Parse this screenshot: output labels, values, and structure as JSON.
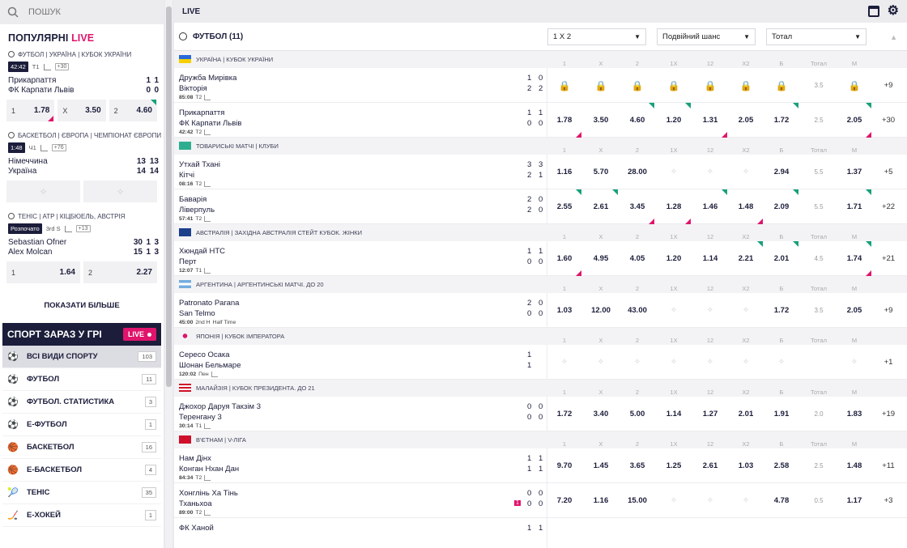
{
  "search": {
    "placeholder": "ПОШУК"
  },
  "popular": {
    "title": "ПОПУЛЯРНІ",
    "live": "LIVE"
  },
  "pop_matches": [
    {
      "league": "ФУТБОЛ | УКРАЇНА | КУБОК УКРАЇНИ",
      "time": "42:42",
      "period": "T1",
      "count": "+30",
      "team1": "Прикарпаття",
      "team2": "ФК Карпати Львів",
      "s1a": "1",
      "s1b": "1",
      "s2a": "0",
      "s2b": "0",
      "odds": [
        {
          "l": "1",
          "v": "1.78"
        },
        {
          "l": "X",
          "v": "3.50"
        },
        {
          "l": "2",
          "v": "4.60"
        }
      ]
    },
    {
      "league": "БАСКЕТБОЛ | ЄВРОПА | ЧЕМПІОНАТ ЄВРОПИ 2...",
      "time": "1:48",
      "period": "Ч1",
      "count": "+76",
      "team1": "Німеччина",
      "team2": "Україна",
      "s1a": "13",
      "s1b": "13",
      "s2a": "14",
      "s2b": "14"
    },
    {
      "league": "ТЕНІС | ATP | КІЦБЮЕЛЬ, АВСТРІЯ",
      "time": "Розпочато",
      "period": "3rd S",
      "count": "+13",
      "team1": "Sebastian Ofner",
      "team2": "Alex Molcan",
      "s1a": "30",
      "s1b": "1",
      "s1c": "3",
      "s2a": "15",
      "s2b": "1",
      "s2c": "3",
      "odds": [
        {
          "l": "1",
          "v": "1.64"
        },
        {
          "l": "2",
          "v": "2.27"
        }
      ]
    }
  ],
  "show_more": "ПОКАЗАТИ БІЛЬШЕ",
  "sport_now": {
    "title": "СПОРТ ЗАРАЗ У ГРІ",
    "live": "LIVE"
  },
  "sports": [
    {
      "label": "ВСІ ВИДИ СПОРТУ",
      "count": "103",
      "icon": "⚽"
    },
    {
      "label": "ФУТБОЛ",
      "count": "11",
      "icon": "⚽"
    },
    {
      "label": "ФУТБОЛ. СТАТИСТИКА",
      "count": "3",
      "icon": "⚽"
    },
    {
      "label": "Е-ФУТБОЛ",
      "count": "1",
      "icon": "⚽"
    },
    {
      "label": "БАСКЕТБОЛ",
      "count": "16",
      "icon": "🏀"
    },
    {
      "label": "Е-БАСКЕТБОЛ",
      "count": "4",
      "icon": "🏀"
    },
    {
      "label": "ТЕНІС",
      "count": "35",
      "icon": "🎾"
    },
    {
      "label": "Е-ХОКЕЙ",
      "count": "1",
      "icon": "🏒"
    }
  ],
  "topbar": {
    "title": "LIVE"
  },
  "football": {
    "title": "ФУТБОЛ (11)",
    "sel1": "1 X 2",
    "sel2": "Подвійний шанс",
    "sel3": "Тотал"
  },
  "columns": [
    "1",
    "X",
    "2",
    "1X",
    "12",
    "X2",
    "Б",
    "Тотал",
    "М"
  ],
  "leagues": [
    {
      "name": "УКРАЇНА | КУБОК УКРАЇНИ",
      "flag": "ua",
      "matches": [
        {
          "t1": "Дружба Мирівка",
          "t2": "Вікторія",
          "time": "85:08",
          "period": "T2",
          "extra": "",
          "sc": [
            "1",
            "0",
            "2",
            "2"
          ],
          "locked": true,
          "tot": "3.5",
          "plus": "+9"
        },
        {
          "t1": "Прикарпаття",
          "t2": "ФК Карпати Львів",
          "time": "42:42",
          "period": "T2",
          "extra": "",
          "sc": [
            "1",
            "1",
            "0",
            "0"
          ],
          "odds": [
            "1.78",
            "3.50",
            "4.60",
            "1.20",
            "1.31",
            "2.05",
            "1.72",
            "2.5",
            "2.05"
          ],
          "up": [
            2,
            3,
            6,
            8
          ],
          "dn": [
            0,
            4,
            8
          ],
          "plus": "+30"
        }
      ]
    },
    {
      "name": "ТОВАРИСЬКІ МАТЧІ | КЛУБИ",
      "flag": "intl",
      "matches": [
        {
          "t1": "Утхай Тхані",
          "t2": "Кітчі",
          "time": "08:16",
          "period": "T2",
          "extra": "",
          "sc": [
            "3",
            "3",
            "2",
            "1"
          ],
          "odds": [
            "1.16",
            "5.70",
            "28.00",
            "",
            "",
            "",
            "2.94",
            "5.5",
            "1.37"
          ],
          "plus": "+5"
        },
        {
          "t1": "Баварія",
          "t2": "Ліверпуль",
          "time": "57:41",
          "period": "T2",
          "extra": "",
          "sc": [
            "2",
            "0",
            "2",
            "0"
          ],
          "odds": [
            "2.55",
            "2.61",
            "3.45",
            "1.28",
            "1.46",
            "1.48",
            "2.09",
            "5.5",
            "1.71"
          ],
          "up": [
            0,
            1,
            4,
            6,
            8
          ],
          "dn": [
            2,
            3,
            5,
            7
          ],
          "plus": "+22"
        }
      ]
    },
    {
      "name": "АВСТРАЛІЯ | ЗАХІДНА АВСТРАЛІЯ СТЕЙТ КУБОК. ЖІНКИ",
      "flag": "au",
      "matches": [
        {
          "t1": "Хюндай НТС",
          "t2": "Перт",
          "time": "12:07",
          "period": "T1",
          "extra": "",
          "sc": [
            "1",
            "1",
            "0",
            "0"
          ],
          "odds": [
            "1.60",
            "4.95",
            "4.05",
            "1.20",
            "1.14",
            "2.21",
            "2.01",
            "4.5",
            "1.74"
          ],
          "up": [
            5,
            6,
            8
          ],
          "dn": [
            0,
            8
          ],
          "plus": "+21"
        }
      ]
    },
    {
      "name": "АРГЕНТИНА | АРГЕНТИНСЬКІ МАТЧІ. ДО 20",
      "flag": "ar",
      "matches": [
        {
          "t1": "Patronato Parana",
          "t2": "San Telmo",
          "time": "45:00",
          "period": "2nd H",
          "extra": "Half Time",
          "sc": [
            "2",
            "0",
            "0",
            "0"
          ],
          "odds": [
            "1.03",
            "12.00",
            "43.00",
            "",
            "",
            "",
            "1.72",
            "3.5",
            "2.05"
          ],
          "plus": "+9"
        }
      ]
    },
    {
      "name": "ЯПОНІЯ | КУБОК ІМПЕРАТОРА",
      "flag": "jp",
      "matches": [
        {
          "t1": "Сересо Осака",
          "t2": "Шонан Бельмаре",
          "time": "120:02",
          "period": "Пен",
          "extra": "",
          "sc": [
            "1",
            "",
            "1",
            ""
          ],
          "odds": [
            "",
            "",
            "",
            "",
            "",
            "",
            "",
            "",
            ""
          ],
          "plus": "+1"
        }
      ]
    },
    {
      "name": "МАЛАЙЗІЯ | КУБОК ПРЕЗИДЕНТА. ДО 21",
      "flag": "my",
      "matches": [
        {
          "t1": "Джохор Даруя Такзім 3",
          "t2": "Теренгану 3",
          "time": "30:14",
          "period": "T1",
          "extra": "",
          "sc": [
            "0",
            "0",
            "0",
            "0"
          ],
          "odds": [
            "1.72",
            "3.40",
            "5.00",
            "1.14",
            "1.27",
            "2.01",
            "1.91",
            "2.0",
            "1.83"
          ],
          "plus": "+19"
        }
      ]
    },
    {
      "name": "В'ЄТНАМ | V-ЛІГА",
      "flag": "vn",
      "matches": [
        {
          "t1": "Нам Дінх",
          "t2": "Конган Нхан Дан",
          "time": "84:34",
          "period": "T2",
          "extra": "",
          "sc": [
            "1",
            "1",
            "1",
            "1"
          ],
          "odds": [
            "9.70",
            "1.45",
            "3.65",
            "1.25",
            "2.61",
            "1.03",
            "2.58",
            "2.5",
            "1.48"
          ],
          "plus": "+11"
        },
        {
          "t1": "Хонглінь Ха Тінь",
          "t2": "Тханьхоа",
          "time": "89:00",
          "period": "T2",
          "extra": "",
          "sc": [
            "0",
            "0",
            "0",
            "0"
          ],
          "redcard": "1",
          "odds": [
            "7.20",
            "1.16",
            "15.00",
            "",
            "",
            "",
            "4.78",
            "0.5",
            "1.17"
          ],
          "plus": "+3"
        },
        {
          "t1": "ФК Ханой",
          "t2": "",
          "time": "",
          "period": "",
          "extra": "",
          "sc": [
            "1",
            "1",
            "",
            ""
          ],
          "odds": [
            "",
            "",
            "",
            "",
            "",
            "",
            "",
            "",
            ""
          ],
          "plus": "",
          "partial": true
        }
      ]
    }
  ]
}
